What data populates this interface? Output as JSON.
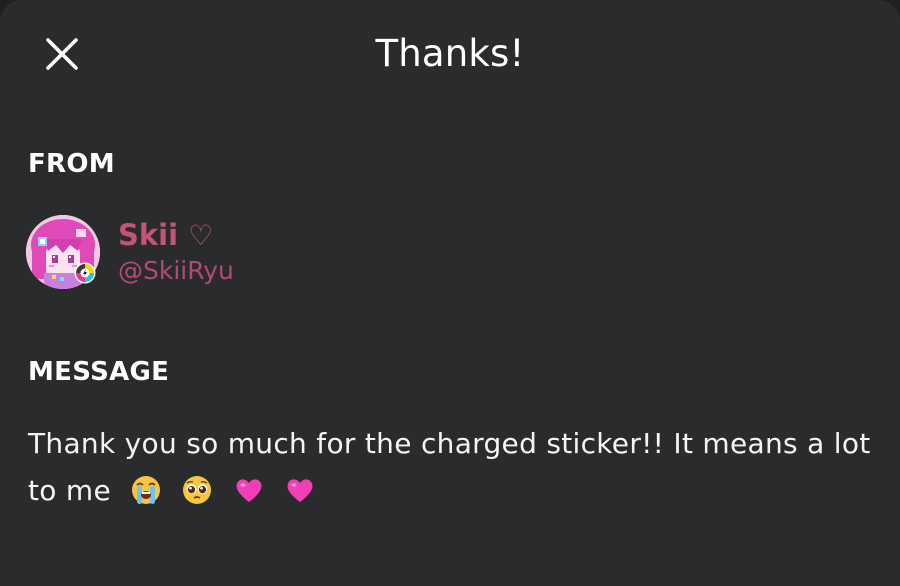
{
  "header": {
    "title": "Thanks!",
    "close_icon": "close-icon"
  },
  "from": {
    "label": "FROM",
    "sender": {
      "display_name": "Skii",
      "name_symbol": "♡",
      "handle": "@SkiiRyu",
      "name_color": "#c4537b",
      "handle_color": "#b24a72"
    }
  },
  "message": {
    "label": "MESSAGE",
    "text": "Thank you so much for the charged sticker!! It means a lot to me",
    "emojis": [
      "loudly-crying-face",
      "pleading-face",
      "pink-heart",
      "pink-heart"
    ]
  },
  "colors": {
    "background": "#2a2b2c",
    "text": "#ffffff"
  }
}
